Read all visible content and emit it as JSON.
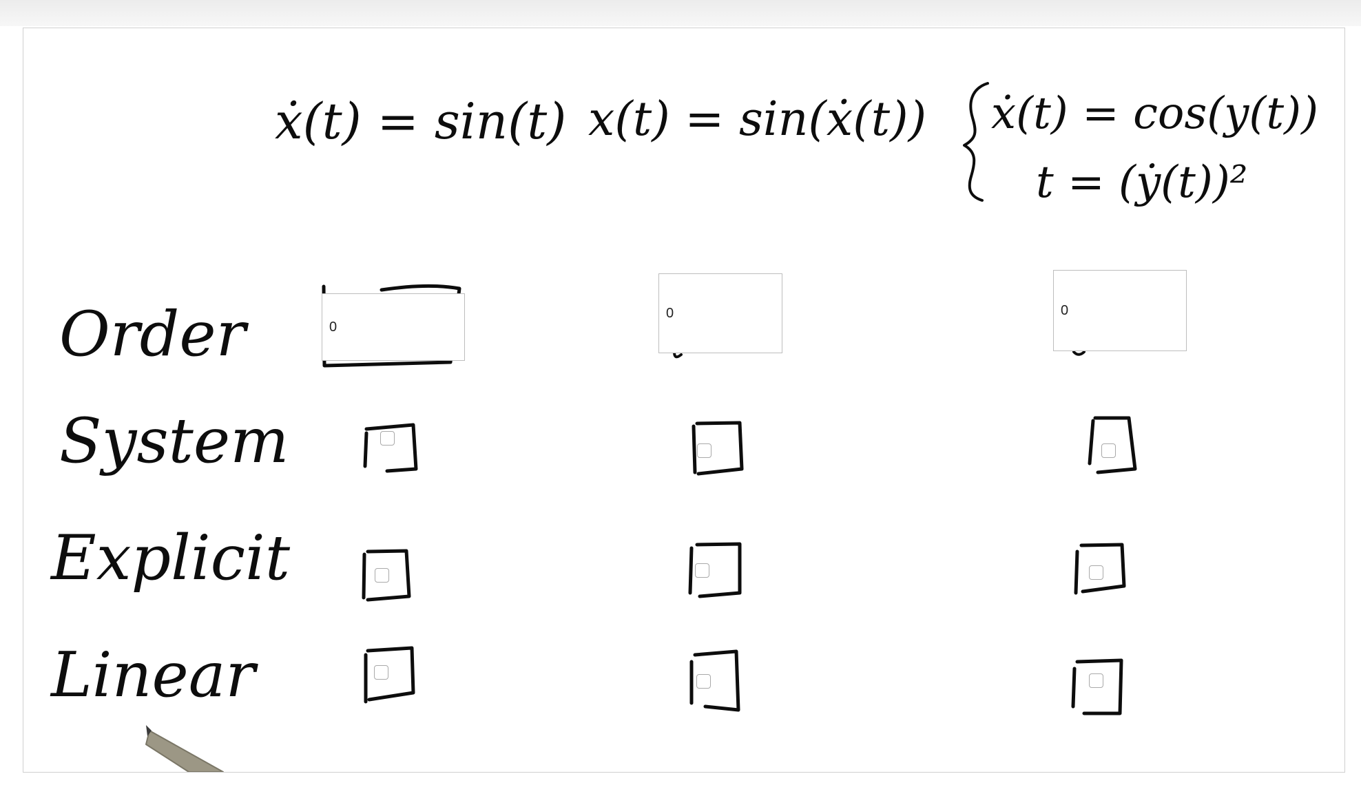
{
  "columns": [
    {
      "id": "eq1",
      "equation_lines": [
        "ẋ(t) = sin(t)"
      ],
      "order_value": "0"
    },
    {
      "id": "eq2",
      "equation_lines": [
        "x(t) = sin(ẋ(t))"
      ],
      "order_value": "0"
    },
    {
      "id": "eq3",
      "equation_lines": [
        "ẋ(t) = cos(y(t))",
        "t = (ẏ(t))²"
      ],
      "order_value": "0"
    }
  ],
  "rows": {
    "order": "Order",
    "system": "System",
    "explicit": "Explicit",
    "linear": "Linear"
  },
  "checkboxes": {
    "system": [
      false,
      false,
      false
    ],
    "explicit": [
      false,
      false,
      false
    ],
    "linear": [
      false,
      false,
      false
    ]
  },
  "colors": {
    "ink": "#0d0d0d",
    "board_border": "#cfcfcf",
    "checkbox_border": "#a9a9a9",
    "pen_tip": "#9c9785"
  },
  "icons": {
    "pen": "stylus-pen-icon"
  }
}
